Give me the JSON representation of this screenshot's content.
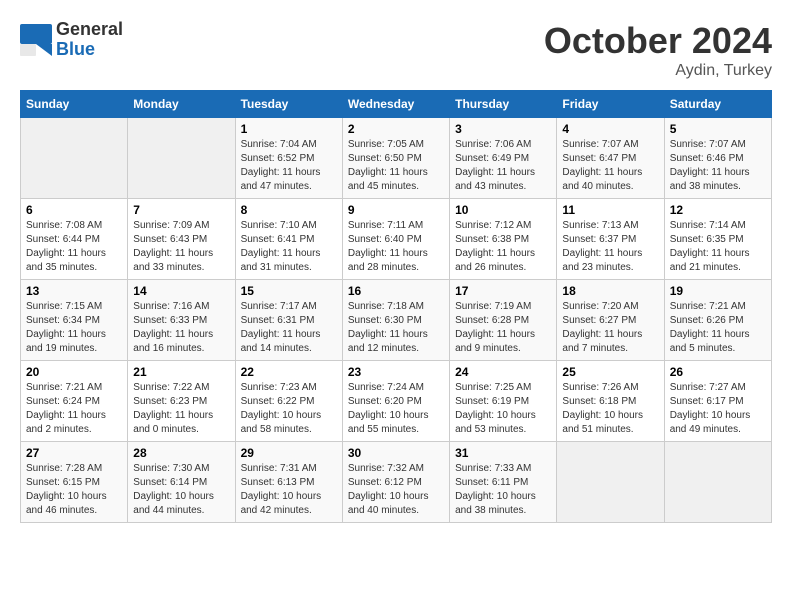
{
  "logo": {
    "general": "General",
    "blue": "Blue"
  },
  "title": "October 2024",
  "subtitle": "Aydin, Turkey",
  "days_header": [
    "Sunday",
    "Monday",
    "Tuesday",
    "Wednesday",
    "Thursday",
    "Friday",
    "Saturday"
  ],
  "weeks": [
    [
      {
        "num": "",
        "empty": true
      },
      {
        "num": "",
        "empty": true
      },
      {
        "num": "1",
        "sunrise": "Sunrise: 7:04 AM",
        "sunset": "Sunset: 6:52 PM",
        "daylight": "Daylight: 11 hours and 47 minutes."
      },
      {
        "num": "2",
        "sunrise": "Sunrise: 7:05 AM",
        "sunset": "Sunset: 6:50 PM",
        "daylight": "Daylight: 11 hours and 45 minutes."
      },
      {
        "num": "3",
        "sunrise": "Sunrise: 7:06 AM",
        "sunset": "Sunset: 6:49 PM",
        "daylight": "Daylight: 11 hours and 43 minutes."
      },
      {
        "num": "4",
        "sunrise": "Sunrise: 7:07 AM",
        "sunset": "Sunset: 6:47 PM",
        "daylight": "Daylight: 11 hours and 40 minutes."
      },
      {
        "num": "5",
        "sunrise": "Sunrise: 7:07 AM",
        "sunset": "Sunset: 6:46 PM",
        "daylight": "Daylight: 11 hours and 38 minutes."
      }
    ],
    [
      {
        "num": "6",
        "sunrise": "Sunrise: 7:08 AM",
        "sunset": "Sunset: 6:44 PM",
        "daylight": "Daylight: 11 hours and 35 minutes."
      },
      {
        "num": "7",
        "sunrise": "Sunrise: 7:09 AM",
        "sunset": "Sunset: 6:43 PM",
        "daylight": "Daylight: 11 hours and 33 minutes."
      },
      {
        "num": "8",
        "sunrise": "Sunrise: 7:10 AM",
        "sunset": "Sunset: 6:41 PM",
        "daylight": "Daylight: 11 hours and 31 minutes."
      },
      {
        "num": "9",
        "sunrise": "Sunrise: 7:11 AM",
        "sunset": "Sunset: 6:40 PM",
        "daylight": "Daylight: 11 hours and 28 minutes."
      },
      {
        "num": "10",
        "sunrise": "Sunrise: 7:12 AM",
        "sunset": "Sunset: 6:38 PM",
        "daylight": "Daylight: 11 hours and 26 minutes."
      },
      {
        "num": "11",
        "sunrise": "Sunrise: 7:13 AM",
        "sunset": "Sunset: 6:37 PM",
        "daylight": "Daylight: 11 hours and 23 minutes."
      },
      {
        "num": "12",
        "sunrise": "Sunrise: 7:14 AM",
        "sunset": "Sunset: 6:35 PM",
        "daylight": "Daylight: 11 hours and 21 minutes."
      }
    ],
    [
      {
        "num": "13",
        "sunrise": "Sunrise: 7:15 AM",
        "sunset": "Sunset: 6:34 PM",
        "daylight": "Daylight: 11 hours and 19 minutes."
      },
      {
        "num": "14",
        "sunrise": "Sunrise: 7:16 AM",
        "sunset": "Sunset: 6:33 PM",
        "daylight": "Daylight: 11 hours and 16 minutes."
      },
      {
        "num": "15",
        "sunrise": "Sunrise: 7:17 AM",
        "sunset": "Sunset: 6:31 PM",
        "daylight": "Daylight: 11 hours and 14 minutes."
      },
      {
        "num": "16",
        "sunrise": "Sunrise: 7:18 AM",
        "sunset": "Sunset: 6:30 PM",
        "daylight": "Daylight: 11 hours and 12 minutes."
      },
      {
        "num": "17",
        "sunrise": "Sunrise: 7:19 AM",
        "sunset": "Sunset: 6:28 PM",
        "daylight": "Daylight: 11 hours and 9 minutes."
      },
      {
        "num": "18",
        "sunrise": "Sunrise: 7:20 AM",
        "sunset": "Sunset: 6:27 PM",
        "daylight": "Daylight: 11 hours and 7 minutes."
      },
      {
        "num": "19",
        "sunrise": "Sunrise: 7:21 AM",
        "sunset": "Sunset: 6:26 PM",
        "daylight": "Daylight: 11 hours and 5 minutes."
      }
    ],
    [
      {
        "num": "20",
        "sunrise": "Sunrise: 7:21 AM",
        "sunset": "Sunset: 6:24 PM",
        "daylight": "Daylight: 11 hours and 2 minutes."
      },
      {
        "num": "21",
        "sunrise": "Sunrise: 7:22 AM",
        "sunset": "Sunset: 6:23 PM",
        "daylight": "Daylight: 11 hours and 0 minutes."
      },
      {
        "num": "22",
        "sunrise": "Sunrise: 7:23 AM",
        "sunset": "Sunset: 6:22 PM",
        "daylight": "Daylight: 10 hours and 58 minutes."
      },
      {
        "num": "23",
        "sunrise": "Sunrise: 7:24 AM",
        "sunset": "Sunset: 6:20 PM",
        "daylight": "Daylight: 10 hours and 55 minutes."
      },
      {
        "num": "24",
        "sunrise": "Sunrise: 7:25 AM",
        "sunset": "Sunset: 6:19 PM",
        "daylight": "Daylight: 10 hours and 53 minutes."
      },
      {
        "num": "25",
        "sunrise": "Sunrise: 7:26 AM",
        "sunset": "Sunset: 6:18 PM",
        "daylight": "Daylight: 10 hours and 51 minutes."
      },
      {
        "num": "26",
        "sunrise": "Sunrise: 7:27 AM",
        "sunset": "Sunset: 6:17 PM",
        "daylight": "Daylight: 10 hours and 49 minutes."
      }
    ],
    [
      {
        "num": "27",
        "sunrise": "Sunrise: 7:28 AM",
        "sunset": "Sunset: 6:15 PM",
        "daylight": "Daylight: 10 hours and 46 minutes."
      },
      {
        "num": "28",
        "sunrise": "Sunrise: 7:30 AM",
        "sunset": "Sunset: 6:14 PM",
        "daylight": "Daylight: 10 hours and 44 minutes."
      },
      {
        "num": "29",
        "sunrise": "Sunrise: 7:31 AM",
        "sunset": "Sunset: 6:13 PM",
        "daylight": "Daylight: 10 hours and 42 minutes."
      },
      {
        "num": "30",
        "sunrise": "Sunrise: 7:32 AM",
        "sunset": "Sunset: 6:12 PM",
        "daylight": "Daylight: 10 hours and 40 minutes."
      },
      {
        "num": "31",
        "sunrise": "Sunrise: 7:33 AM",
        "sunset": "Sunset: 6:11 PM",
        "daylight": "Daylight: 10 hours and 38 minutes."
      },
      {
        "num": "",
        "empty": true
      },
      {
        "num": "",
        "empty": true
      }
    ]
  ]
}
